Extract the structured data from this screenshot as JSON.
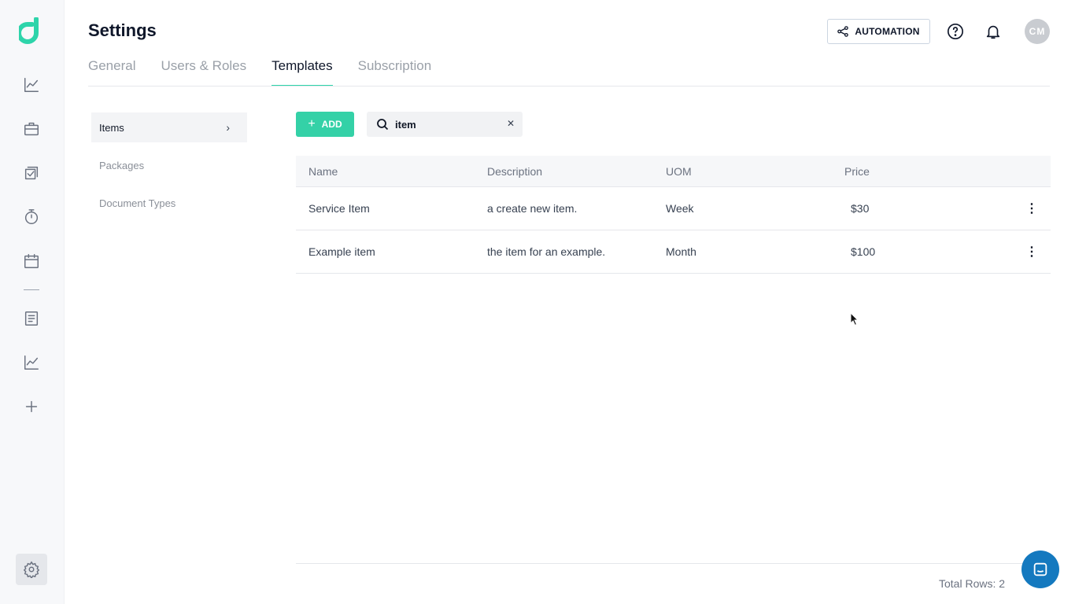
{
  "header": {
    "title": "Settings",
    "automation_label": "AUTOMATION",
    "avatar_initials": "CM"
  },
  "tabs": [
    {
      "label": "General",
      "active": false
    },
    {
      "label": "Users & Roles",
      "active": false
    },
    {
      "label": "Templates",
      "active": true
    },
    {
      "label": "Subscription",
      "active": false
    }
  ],
  "subnav": [
    {
      "label": "Items",
      "active": true
    },
    {
      "label": "Packages",
      "active": false
    },
    {
      "label": "Document Types",
      "active": false
    }
  ],
  "toolbar": {
    "add_label": "ADD",
    "search_value": "item"
  },
  "table": {
    "columns": [
      "Name",
      "Description",
      "UOM",
      "Price"
    ],
    "rows": [
      {
        "name": "Service Item",
        "description": "a create new item.",
        "uom": "Week",
        "price": "$30"
      },
      {
        "name": "Example item",
        "description": "the item for an example.",
        "uom": "Month",
        "price": "$100"
      }
    ],
    "footer": "Total Rows: 2"
  },
  "colors": {
    "accent": "#34d1a7",
    "chat": "#1479bf"
  },
  "icons": {
    "rail": [
      "chart-line-icon",
      "briefcase-icon",
      "checklist-icon",
      "timer-icon",
      "calendar-icon",
      "document-icon",
      "report-chart-icon",
      "plus-icon",
      "gear-icon"
    ],
    "header": [
      "help-icon",
      "bell-icon"
    ]
  }
}
